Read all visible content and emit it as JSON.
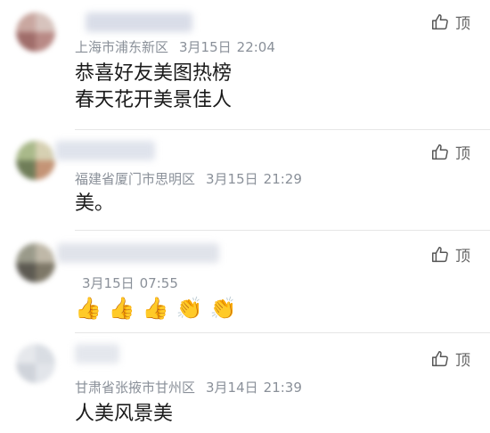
{
  "like_label": "顶",
  "comments": [
    {
      "location": "上海市浦东新区",
      "date": "3月15日",
      "time": "22:04",
      "lines": [
        "恭喜好友美图热榜",
        "春天花开美景佳人"
      ]
    },
    {
      "location": "福建省厦门市思明区",
      "date": "3月15日",
      "time": "21:29",
      "lines": [
        "美。"
      ]
    },
    {
      "location": "",
      "date": "3月15日",
      "time": "07:55",
      "emojis": [
        "👍",
        "👍",
        "👍",
        "👏",
        "👏"
      ]
    },
    {
      "location": "甘肃省张掖市甘州区",
      "date": "3月14日",
      "time": "21:39",
      "lines": [
        "人美风景美"
      ]
    }
  ],
  "colors": {
    "meta": "#8a9099",
    "divider": "#e6e6e6",
    "text": "#1a1a1a"
  }
}
